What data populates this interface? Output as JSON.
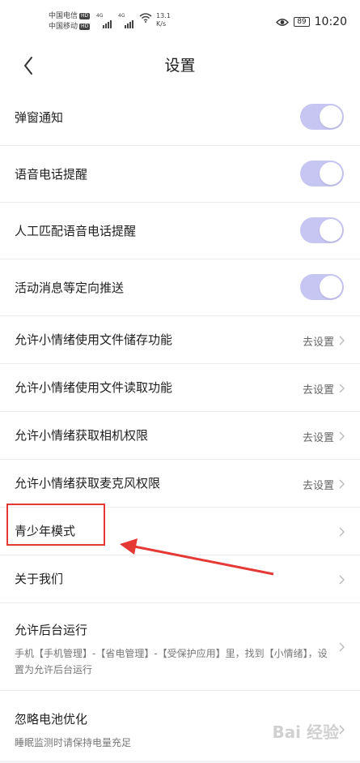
{
  "status_bar": {
    "carrier1": "中国电信",
    "carrier2": "中国移动",
    "hd": "HD",
    "net1": "4G",
    "net2": "4G",
    "speed_value": "13.1",
    "speed_unit": "K/s",
    "battery": "89",
    "time": "10:20"
  },
  "header": {
    "title": "设置"
  },
  "items": [
    {
      "label": "弹窗通知",
      "toggle": true
    },
    {
      "label": "语音电话提醒",
      "toggle": true
    },
    {
      "label": "人工匹配语音电话提醒",
      "toggle": true
    },
    {
      "label": "活动消息等定向推送",
      "toggle": true
    },
    {
      "label": "允许小情绪使用文件储存功能",
      "action": "去设置"
    },
    {
      "label": "允许小情绪使用文件读取功能",
      "action": "去设置"
    },
    {
      "label": "允许小情绪获取相机权限",
      "action": "去设置"
    },
    {
      "label": "允许小情绪获取麦克风权限",
      "action": "去设置"
    },
    {
      "label": "青少年模式"
    },
    {
      "label": "关于我们"
    },
    {
      "label": "允许后台运行",
      "desc": "手机【手机管理】-【省电管理】-【受保护应用】里，找到【小情绪】，设置为允许后台运行"
    },
    {
      "label": "忽略电池优化",
      "desc": "睡眠监测时请保持电量充足"
    }
  ],
  "watermark": "Bai 经验",
  "colors": {
    "toggle_on": "#c7c5f2",
    "annotation_red": "#e53935"
  }
}
